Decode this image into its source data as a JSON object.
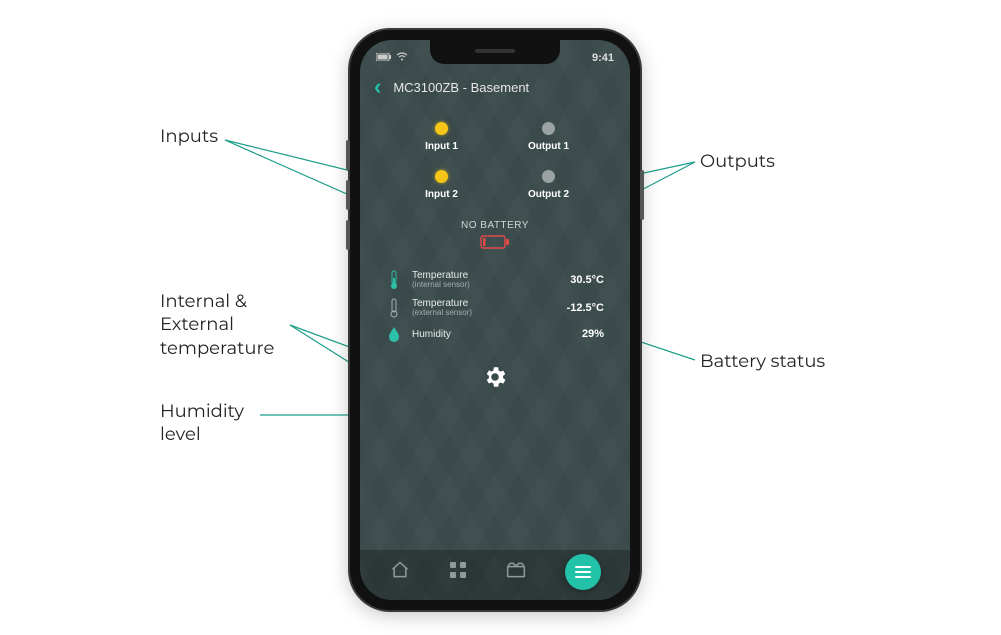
{
  "status": {
    "time": "9:41"
  },
  "header": {
    "title": "MC3100ZB - Basement"
  },
  "io": {
    "inputs": [
      {
        "label": "Input 1",
        "active": true
      },
      {
        "label": "Input 2",
        "active": true
      }
    ],
    "outputs": [
      {
        "label": "Output 1",
        "active": false
      },
      {
        "label": "Output 2",
        "active": false
      }
    ]
  },
  "battery": {
    "label": "NO BATTERY"
  },
  "sensors": {
    "temp_internal": {
      "name": "Temperature",
      "sub": "(internal sensor)",
      "value": "30.5°C"
    },
    "temp_external": {
      "name": "Temperature",
      "sub": "(external sensor)",
      "value": "-12.5°C"
    },
    "humidity": {
      "name": "Humidity",
      "value": "29%"
    }
  },
  "annotations": {
    "inputs": "Inputs",
    "outputs": "Outputs",
    "temp": "Internal &\nExternal\ntemperature",
    "humidity": "Humidity\nlevel",
    "battery": "Battery status"
  }
}
